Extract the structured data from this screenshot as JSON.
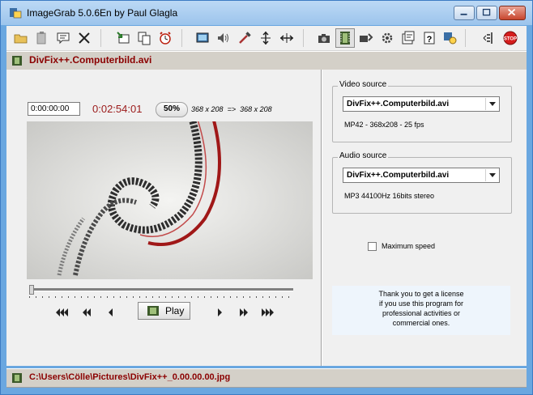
{
  "window": {
    "title": "ImageGrab 5.0.6En by Paul Glagla"
  },
  "toolbar": {
    "icons": [
      "open-icon",
      "paste-icon",
      "comment-icon",
      "close-file-icon",
      "import-icon",
      "copy-icon",
      "timer-icon",
      "fullscreen-icon",
      "audio-icon",
      "tools-icon",
      "split-icon",
      "flip-icon",
      "camera-icon",
      "film-icon",
      "burst-icon",
      "settings-icon",
      "properties-icon",
      "help-icon",
      "license-icon",
      "exit-icon",
      "stop-icon"
    ]
  },
  "file": {
    "name": "DivFix++.Computerbild.avi"
  },
  "player": {
    "position": "0:00:00:00",
    "duration": "0:02:54:01",
    "zoom": "50%",
    "dims_source": "368 x 208",
    "dims_arrow": "=>",
    "dims_target": "368 x 208",
    "progress": 0.0,
    "play_label": "Play"
  },
  "video_source": {
    "legend": "Video source",
    "selected": "DivFix++.Computerbild.avi",
    "info": "MP42 - 368x208 - 25 fps"
  },
  "audio_source": {
    "legend": "Audio source",
    "selected": "DivFix++.Computerbild.avi",
    "info": "MP3 44100Hz 16bits  stereo"
  },
  "options": {
    "max_speed_label": "Maximum speed",
    "max_speed_checked": false
  },
  "license": {
    "lines": [
      "Thank you to get a license",
      "if you use this program for",
      "professional activities or",
      "commercial ones."
    ]
  },
  "status": {
    "path": "C:\\Users\\Cölle\\Pictures\\DivFix++_0.00.00.00.jpg"
  },
  "colors": {
    "accent_red": "#8b0000",
    "title_blue": "#9cc4ec",
    "license_bg": "#eef5fc"
  }
}
